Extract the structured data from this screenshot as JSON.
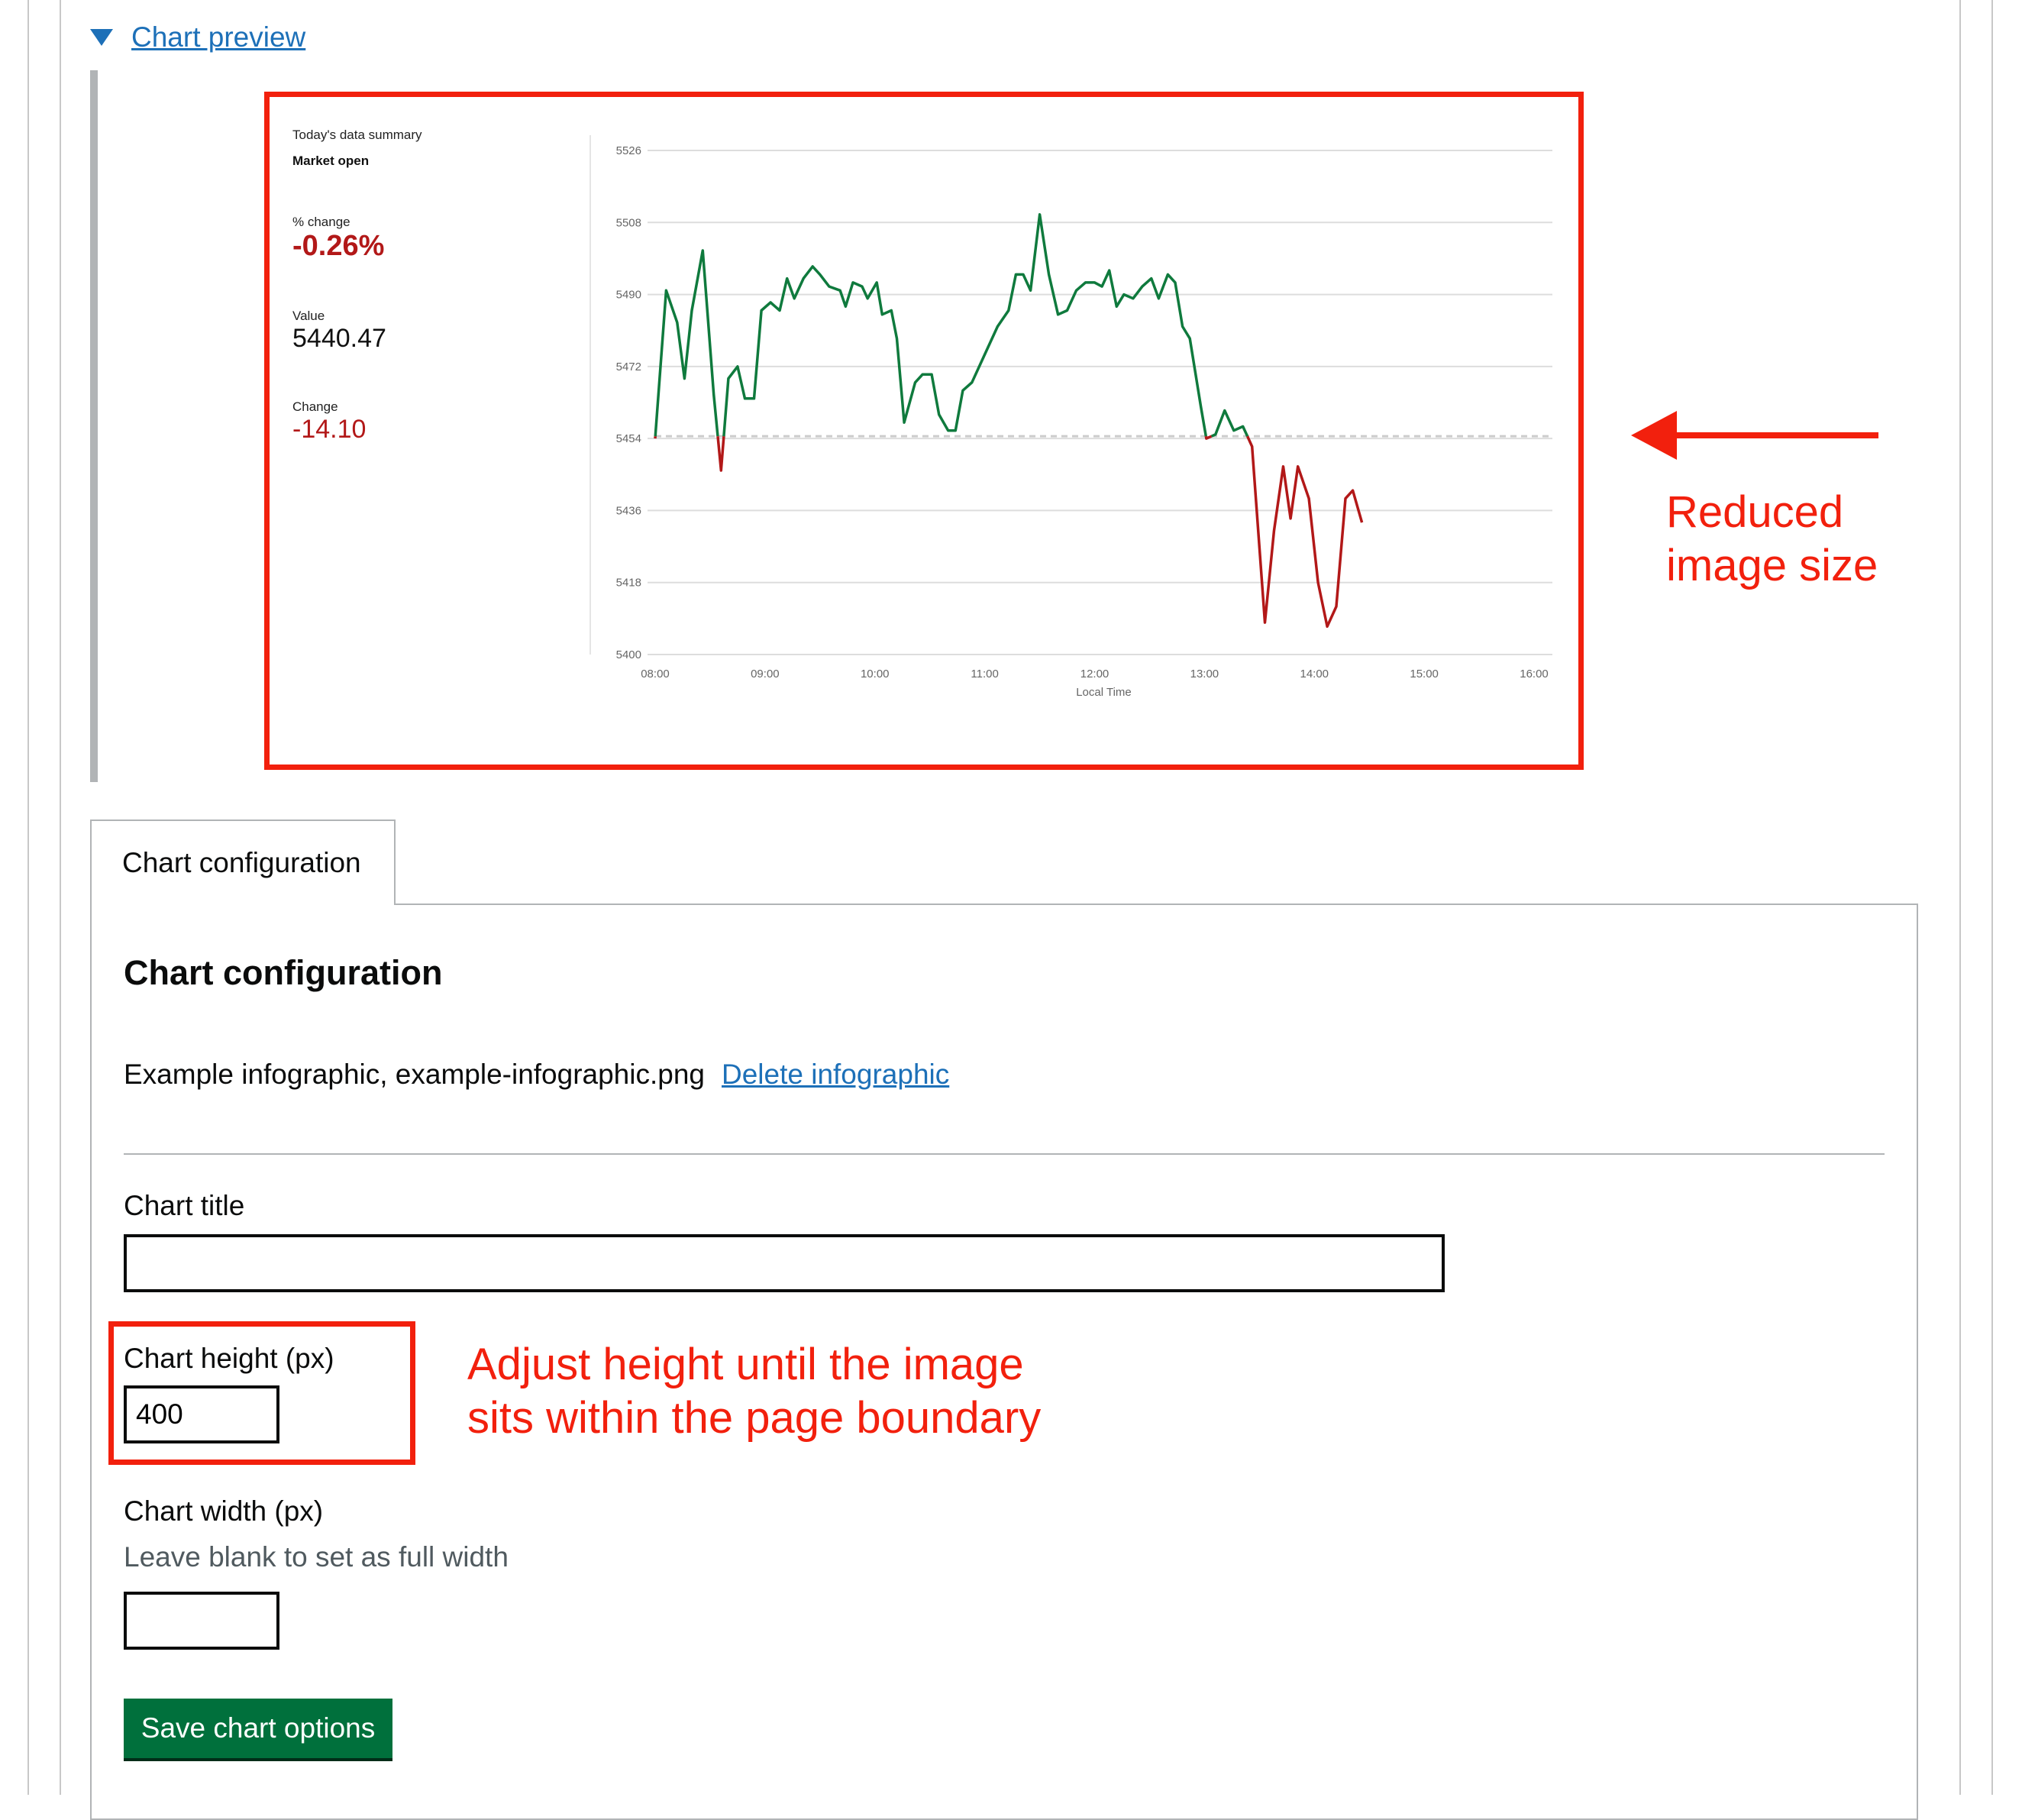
{
  "details": {
    "summary_label": "Chart preview"
  },
  "preview": {
    "summary": {
      "heading": "Today's data summary",
      "status": "Market open",
      "pct_label": "% change",
      "pct_value": "-0.26%",
      "value_label": "Value",
      "value": "5440.47",
      "change_label": "Change",
      "change": "-14.10"
    }
  },
  "chart_data": {
    "type": "line",
    "xlabel": "Local Time",
    "ylabel": "",
    "x_ticks": [
      "08:00",
      "09:00",
      "10:00",
      "11:00",
      "12:00",
      "13:00",
      "14:00",
      "15:00",
      "16:00"
    ],
    "y_ticks": [
      "5526",
      "5508",
      "5490",
      "5472",
      "5454",
      "5436",
      "5418",
      "5400"
    ],
    "ylim": [
      5400,
      5526
    ],
    "xlim": [
      "08:00",
      "16:10"
    ],
    "reference_value": 5454.57,
    "reference_style": "dashed",
    "colors": {
      "above": "#0f7a3d",
      "below": "#b21818",
      "grid": "#dddddd",
      "reference": "#cccccc"
    },
    "series": [
      {
        "points": [
          [
            "08:00",
            5454
          ],
          [
            "08:06",
            5491
          ],
          [
            "08:12",
            5483
          ],
          [
            "08:16",
            5469
          ],
          [
            "08:20",
            5486
          ],
          [
            "08:26",
            5501
          ],
          [
            "08:32",
            5465
          ],
          [
            "08:36",
            5446
          ],
          [
            "08:40",
            5469
          ],
          [
            "08:45",
            5472
          ],
          [
            "08:49",
            5464
          ],
          [
            "08:54",
            5464
          ],
          [
            "08:58",
            5486
          ],
          [
            "09:03",
            5488
          ],
          [
            "09:08",
            5486
          ],
          [
            "09:12",
            5494
          ],
          [
            "09:16",
            5489
          ],
          [
            "09:21",
            5494
          ],
          [
            "09:26",
            5497
          ],
          [
            "09:30",
            5495
          ],
          [
            "09:35",
            5492
          ],
          [
            "09:41",
            5491
          ],
          [
            "09:44",
            5487
          ],
          [
            "09:48",
            5493
          ],
          [
            "09:53",
            5492
          ],
          [
            "09:56",
            5489
          ],
          [
            "10:01",
            5493
          ],
          [
            "10:04",
            5485
          ],
          [
            "10:09",
            5486
          ],
          [
            "10:12",
            5479
          ],
          [
            "10:16",
            5458
          ],
          [
            "10:22",
            5468
          ],
          [
            "10:26",
            5470
          ],
          [
            "10:31",
            5470
          ],
          [
            "10:35",
            5460
          ],
          [
            "10:40",
            5456
          ],
          [
            "10:44",
            5456
          ],
          [
            "10:48",
            5466
          ],
          [
            "10:53",
            5468
          ],
          [
            "11:00",
            5475
          ],
          [
            "11:07",
            5482
          ],
          [
            "11:13",
            5486
          ],
          [
            "11:17",
            5495
          ],
          [
            "11:21",
            5495
          ],
          [
            "11:25",
            5491
          ],
          [
            "11:30",
            5510
          ],
          [
            "11:35",
            5495
          ],
          [
            "11:40",
            5485
          ],
          [
            "11:45",
            5486
          ],
          [
            "11:50",
            5491
          ],
          [
            "11:55",
            5493
          ],
          [
            "12:00",
            5493
          ],
          [
            "12:04",
            5492
          ],
          [
            "12:08",
            5496
          ],
          [
            "12:12",
            5487
          ],
          [
            "12:16",
            5490
          ],
          [
            "12:21",
            5489
          ],
          [
            "12:26",
            5492
          ],
          [
            "12:31",
            5494
          ],
          [
            "12:35",
            5489
          ],
          [
            "12:40",
            5495
          ],
          [
            "12:44",
            5493
          ],
          [
            "12:48",
            5482
          ],
          [
            "12:52",
            5479
          ],
          [
            "12:58",
            5462
          ],
          [
            "13:01",
            5454
          ],
          [
            "13:06",
            5455
          ],
          [
            "13:11",
            5461
          ],
          [
            "13:16",
            5456
          ],
          [
            "13:21",
            5457
          ],
          [
            "13:26",
            5452
          ],
          [
            "13:33",
            5408
          ],
          [
            "13:38",
            5431
          ],
          [
            "13:43",
            5447
          ],
          [
            "13:47",
            5434
          ],
          [
            "13:51",
            5447
          ],
          [
            "13:57",
            5439
          ],
          [
            "14:02",
            5418
          ],
          [
            "14:07",
            5407
          ],
          [
            "14:12",
            5412
          ],
          [
            "14:17",
            5439
          ],
          [
            "14:21",
            5441
          ],
          [
            "14:26",
            5433
          ]
        ]
      }
    ]
  },
  "annotations": {
    "reduced_line1": "Reduced",
    "reduced_line2": "image size",
    "adjust_line1": "Adjust height until the image",
    "adjust_line2": "sits within the page boundary"
  },
  "tabs": [
    {
      "label": "Chart configuration"
    }
  ],
  "config": {
    "heading": "Chart configuration",
    "infographic_text": "Example infographic, example-infographic.png",
    "delete_link": "Delete infographic",
    "title_label": "Chart title",
    "title_value": "",
    "height_label": "Chart height (px)",
    "height_value": "400",
    "width_label": "Chart width (px)",
    "width_hint": "Leave blank to set as full width",
    "width_value": "",
    "save_label": "Save chart options"
  }
}
